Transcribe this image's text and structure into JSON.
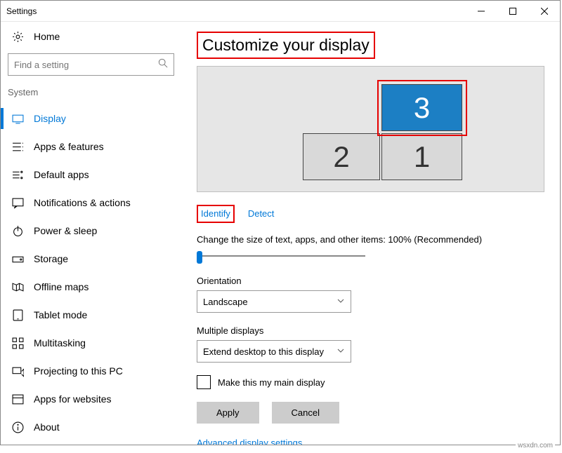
{
  "window": {
    "title": "Settings"
  },
  "sidebar": {
    "home_label": "Home",
    "search_placeholder": "Find a setting",
    "category": "System",
    "items": [
      {
        "label": "Display",
        "icon": "display-icon",
        "active": true
      },
      {
        "label": "Apps & features",
        "icon": "apps-icon",
        "active": false
      },
      {
        "label": "Default apps",
        "icon": "default-apps-icon",
        "active": false
      },
      {
        "label": "Notifications & actions",
        "icon": "notifications-icon",
        "active": false
      },
      {
        "label": "Power & sleep",
        "icon": "power-icon",
        "active": false
      },
      {
        "label": "Storage",
        "icon": "storage-icon",
        "active": false
      },
      {
        "label": "Offline maps",
        "icon": "maps-icon",
        "active": false
      },
      {
        "label": "Tablet mode",
        "icon": "tablet-icon",
        "active": false
      },
      {
        "label": "Multitasking",
        "icon": "multitasking-icon",
        "active": false
      },
      {
        "label": "Projecting to this PC",
        "icon": "projecting-icon",
        "active": false
      },
      {
        "label": "Apps for websites",
        "icon": "apps-websites-icon",
        "active": false
      },
      {
        "label": "About",
        "icon": "about-icon",
        "active": false
      }
    ]
  },
  "main": {
    "title": "Customize your display",
    "monitors": {
      "m1": "1",
      "m2": "2",
      "m3": "3"
    },
    "identify_link": "Identify",
    "detect_link": "Detect",
    "scale_label": "Change the size of text, apps, and other items: 100% (Recommended)",
    "orientation_label": "Orientation",
    "orientation_value": "Landscape",
    "multiple_label": "Multiple displays",
    "multiple_value": "Extend desktop to this display",
    "main_display_checkbox": "Make this my main display",
    "apply_btn": "Apply",
    "cancel_btn": "Cancel",
    "advanced_link": "Advanced display settings"
  },
  "watermark": "wsxdn.com"
}
